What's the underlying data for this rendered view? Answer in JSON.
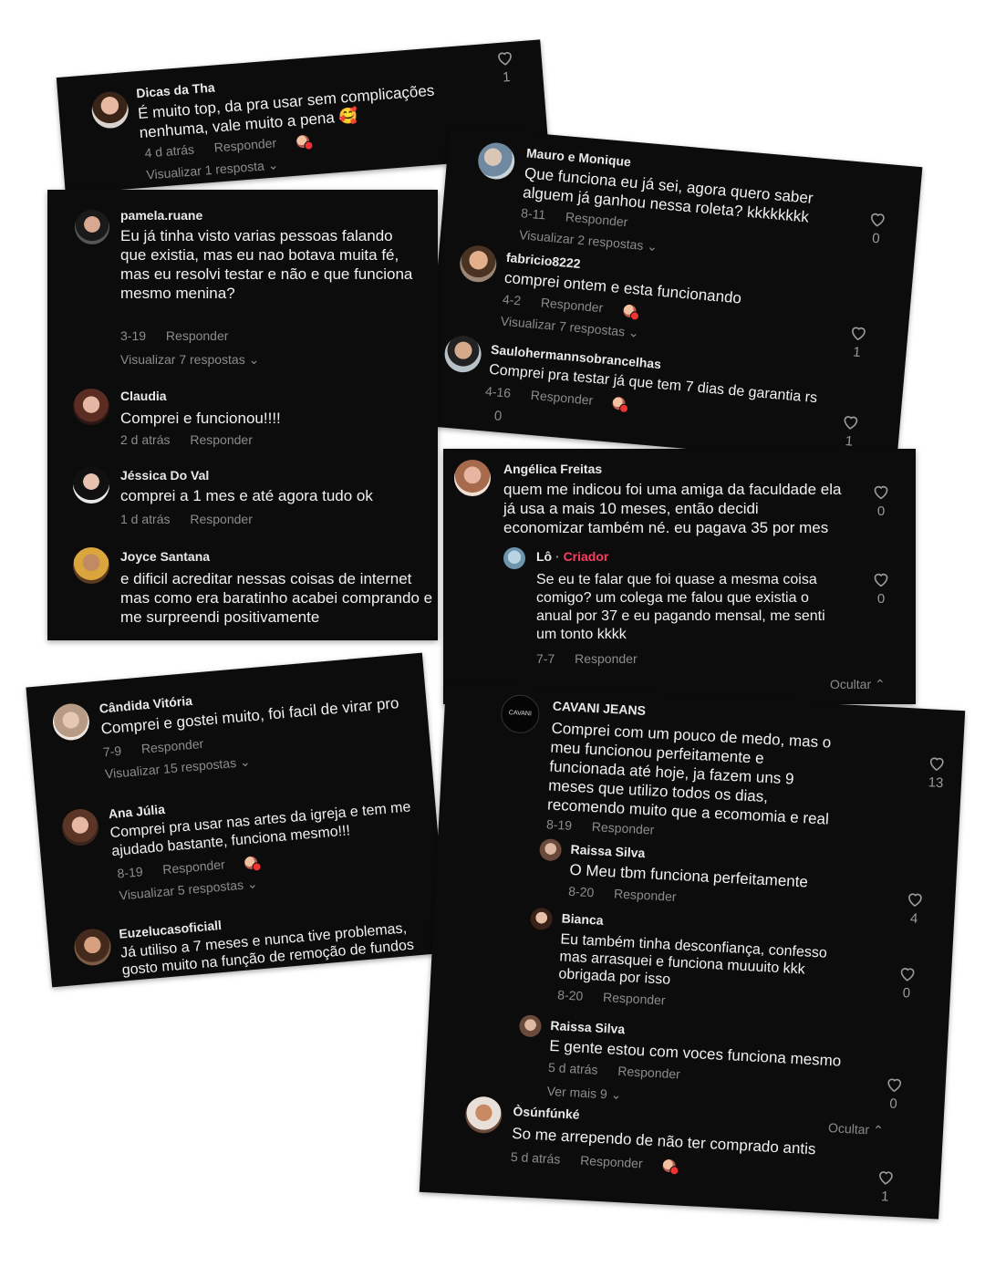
{
  "cards": {
    "c1": {
      "comment": {
        "name": "Dicas da Tha",
        "text": "É muito top, da pra usar sem complicações nenhuma, vale muito a pena 🥰",
        "time": "4 d atrás",
        "reply": "Responder",
        "view_replies": "Visualizar 1 resposta",
        "likes": "1"
      }
    },
    "c2": {
      "comments": [
        {
          "name": "Mauro e Monique",
          "text": "Que funciona eu já sei, agora quero saber alguem já ganhou nessa roleta? kkkkkkkk",
          "time": "8-11",
          "reply": "Responder",
          "view_replies": "Visualizar 2 respostas",
          "likes": "0"
        },
        {
          "name": "fabricio8222",
          "text": "comprei ontem e esta funcionando",
          "time": "4-2",
          "reply": "Responder",
          "view_replies": "Visualizar 7 respostas",
          "likes": "1"
        },
        {
          "name": "Saulohermannsobrancelhas",
          "text": "Comprei pra testar já que tem 7 dias de garantia rs",
          "time": "4-16",
          "reply": "Responder",
          "likes": "1",
          "extra_count": "0"
        }
      ]
    },
    "c3": {
      "comments": [
        {
          "name": "pamela.ruane",
          "text": "Eu já tinha visto varias pessoas falando que existia, mas eu nao botava muita fé, mas eu resolvi testar e não e que funciona mesmo menina?",
          "time": "3-19",
          "reply": "Responder",
          "view_replies": "Visualizar 7 respostas"
        },
        {
          "name": "Claudia",
          "text": "Comprei e funcionou!!!!",
          "time": "2 d atrás",
          "reply": "Responder"
        },
        {
          "name": "Jéssica Do Val",
          "text": "comprei a 1 mes e até agora tudo ok",
          "time": "1 d atrás",
          "reply": "Responder"
        },
        {
          "name": "Joyce Santana",
          "text": "e dificil acreditar nessas coisas de internet mas como era baratinho acabei comprando e me surpreendi positivamente"
        }
      ]
    },
    "c4": {
      "comment": {
        "name": "Angélica Freitas",
        "text": "quem me indicou foi uma amiga da faculdade ela já usa a mais 10 meses, então decidi economizar também né. eu pagava 35 por mes",
        "likes": "0"
      },
      "reply": {
        "name": "Lô",
        "separator": " · ",
        "badge": "Criador",
        "text": "Se eu te falar que foi quase a mesma coisa comigo? um colega me falou que existia o anual por 37 e eu pagando mensal, me senti um tonto kkkk",
        "time": "7-7",
        "reply": "Responder",
        "likes": "0"
      },
      "hide": "Ocultar"
    },
    "c5": {
      "comments": [
        {
          "name": "Cândida Vitória",
          "text": "Comprei e gostei muito, foi facil de virar pro",
          "time": "7-9",
          "reply": "Responder",
          "view_replies": "Visualizar 15 respostas"
        },
        {
          "name": "Ana Júlia",
          "text": "Comprei pra usar nas artes da igreja e tem me ajudado bastante, funciona mesmo!!!",
          "time": "8-19",
          "reply": "Responder",
          "view_replies": "Visualizar 5 respostas"
        },
        {
          "name": "Euzelucasoficiall",
          "text": "Já utiliso a 7 meses e nunca tive problemas, gosto muito na função de remoção de fundos"
        }
      ]
    },
    "c6": {
      "main": {
        "name": "CAVANI JEANS",
        "avatar_text": "CAVANI",
        "text": "Comprei com um pouco de medo, mas o meu funcionou perfeitamente e funcionada até hoje, ja fazem uns 9 meses que utilizo todos os dias, recomendo muito que a ecomomia e real",
        "time": "8-19",
        "reply": "Responder",
        "likes": "13"
      },
      "replies": [
        {
          "name": "Raissa Silva",
          "text": "O Meu tbm funciona perfeitamente",
          "time": "8-20",
          "reply": "Responder",
          "likes": "4"
        },
        {
          "name": "Bianca",
          "text": "Eu também tinha desconfiança, confesso mas arrasquei e funciona muuuito kkk obrigada por isso",
          "time": "8-20",
          "reply": "Responder",
          "likes": "0"
        },
        {
          "name": "Raissa Silva",
          "text": "E gente estou com voces funciona mesmo",
          "time": "5 d atrás",
          "reply": "Responder",
          "likes": "0"
        }
      ],
      "see_more": "Ver mais 9",
      "hide": "Ocultar",
      "last": {
        "name": "Òsúnfúnké",
        "text": "So me arrependo de não ter comprado antis",
        "time": "5 d atrás",
        "reply": "Responder",
        "likes": "1"
      }
    }
  }
}
